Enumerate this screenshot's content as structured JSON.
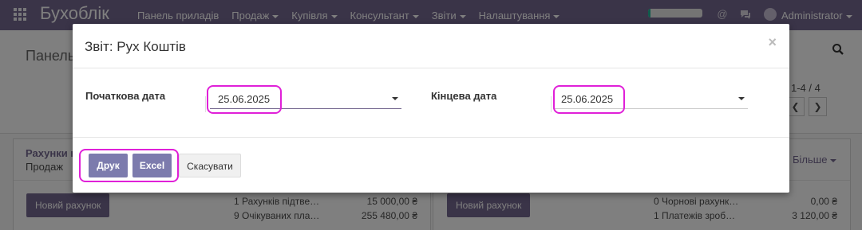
{
  "navbar": {
    "brand": "Бухоблік",
    "menu": [
      {
        "label": "Панель приладів",
        "caret": false
      },
      {
        "label": "Продаж",
        "caret": true
      },
      {
        "label": "Купівля",
        "caret": true
      },
      {
        "label": "Консультант",
        "caret": true
      },
      {
        "label": "Звіти",
        "caret": true
      },
      {
        "label": "Налаштування",
        "caret": true
      }
    ],
    "user": "Administrator",
    "accent_color": "#756890"
  },
  "background": {
    "page_title": "Панель",
    "pager": "1-4 / 4",
    "more_label": "Більше",
    "left_card": {
      "title": "Рахунки к",
      "subtitle": "Продаж",
      "button": "Новий рахунок",
      "lines": [
        {
          "label": "1 Рахунків підтве…",
          "amount": "15 000,00 ₴"
        },
        {
          "label": "9 Очікуваних пла…",
          "amount": "255 480,00 ₴"
        }
      ]
    },
    "right_card": {
      "button": "Новий рахунок",
      "lines": [
        {
          "label": "0 Чорнові рахунк…",
          "amount": "0,00 ₴"
        },
        {
          "label": "1 Платежів зроб…",
          "amount": "3 120,00 ₴"
        }
      ]
    }
  },
  "modal": {
    "title": "Звіт: Рух Коштів",
    "close": "×",
    "start_label": "Початкова дата",
    "start_value": "25.06.2025",
    "end_label": "Кінцева дата",
    "end_value": "25.06.2025",
    "print_label": "Друк",
    "excel_label": "Excel",
    "cancel_label": "Скасувати"
  }
}
